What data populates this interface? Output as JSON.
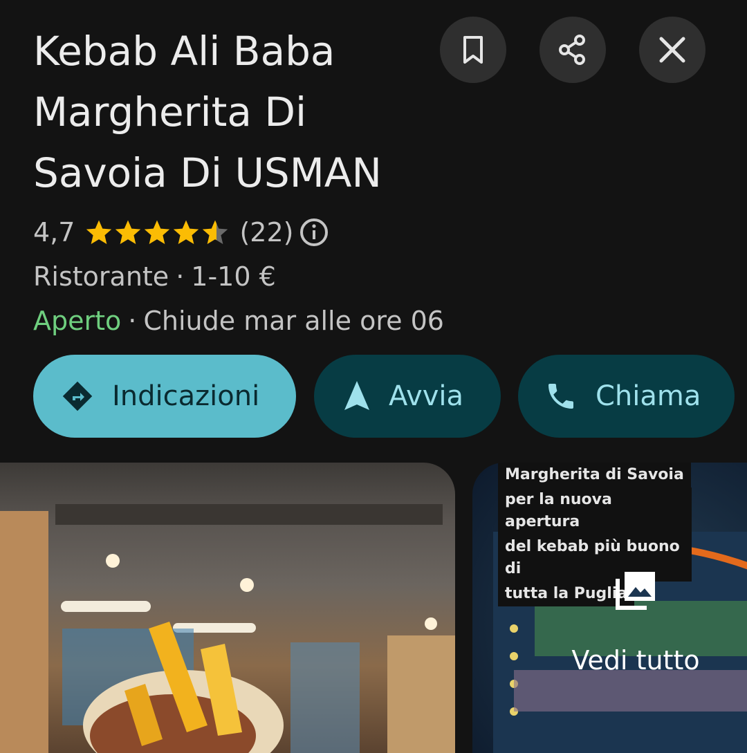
{
  "place": {
    "title_lines": [
      "Kebab Ali Baba",
      "Margherita Di",
      "Savoia Di USMAN"
    ],
    "rating": "4,7",
    "rating_value": 4.7,
    "stars_max": 5,
    "review_count": "(22)",
    "category": "Ristorante",
    "price": "1-10 €",
    "separator": "·",
    "status": "Aperto",
    "hours": "Chiude mar alle ore 06"
  },
  "actions": {
    "save_icon": "bookmark-icon",
    "share_icon": "share-icon",
    "close_icon": "close-icon",
    "buttons": [
      {
        "label": "Indicazioni",
        "icon": "directions-icon"
      },
      {
        "label": "Avvia",
        "icon": "navigation-arrow-icon"
      },
      {
        "label": "Chiama",
        "icon": "phone-icon"
      }
    ]
  },
  "photos": {
    "caption_lines": [
      "Margherita di Savoia",
      "per la nuova apertura",
      "del kebab più buono di",
      "tutta la Puglia"
    ],
    "see_all_label": "Vedi tutto",
    "see_all_icon": "photo-library-icon"
  },
  "colors": {
    "background": "#131313",
    "accent": "#5bbccb",
    "button_dark": "#073c44",
    "star": "#fbbc04",
    "open_status": "#6fcf7f"
  }
}
